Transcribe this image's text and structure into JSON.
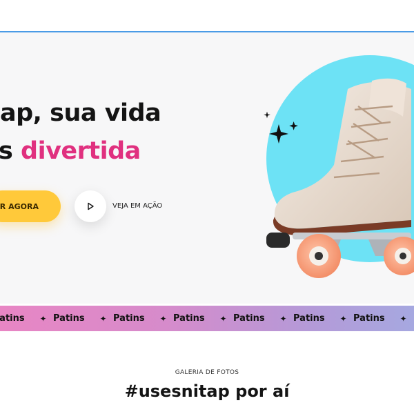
{
  "hero": {
    "headline_line1": "ap, sua vida",
    "headline_line2_prefix": "s ",
    "headline_line2_accent": "divertida",
    "cta_label": "AR AGORA",
    "play_label": "VEJA EM AÇÃO",
    "accent_color": "#e0307f",
    "cta_color": "#ffc93a",
    "circle_color": "#6de2f5",
    "icons": {
      "play": "play-icon",
      "sparkles": "sparkle-icon",
      "product": "roller-skate-icon"
    }
  },
  "marquee": {
    "items": [
      "Patins",
      "Patins",
      "Patins",
      "Patins",
      "Patins",
      "Patins",
      "Patins"
    ],
    "separator": "✦"
  },
  "gallery": {
    "label": "GALERIA DE FOTOS",
    "title": "#usesnitap por aí"
  }
}
